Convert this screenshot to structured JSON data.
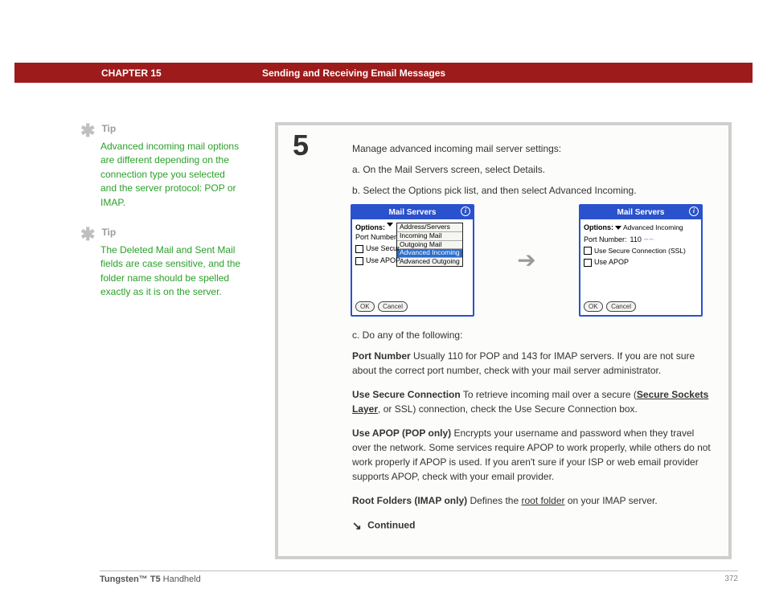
{
  "header": {
    "chapter": "CHAPTER 15",
    "subtitle": "Sending and Receiving Email Messages"
  },
  "tips": [
    {
      "label": "Tip",
      "text": "Advanced incoming mail options are different depending on the connection type you selected and the server protocol: POP or IMAP."
    },
    {
      "label": "Tip",
      "text": "The Deleted Mail and Sent Mail fields are case sensitive, and the folder name should be spelled exactly as it is on the server."
    }
  ],
  "step": {
    "number": "5",
    "intro": "Manage advanced incoming mail server settings:",
    "a": "a.  On the Mail Servers screen, select Details.",
    "b": "b.  Select the Options pick list, and then select Advanced Incoming.",
    "c": "c.  Do any of the following:"
  },
  "screen1": {
    "title": "Mail Servers",
    "options_label": "Options:",
    "port_label": "Port Number",
    "use_secure": "Use Secur",
    "use_apop": "Use APOP",
    "dropdown": [
      "Address/Servers",
      "Incoming Mail",
      "Outgoing Mail",
      "Advanced Incoming",
      "Advanced Outgoing"
    ],
    "ok": "OK",
    "cancel": "Cancel"
  },
  "screen2": {
    "title": "Mail Servers",
    "options_label": "Options:",
    "options_value": "Advanced Incoming",
    "port_label": "Port Number:",
    "port_value": "110",
    "use_secure": "Use Secure Connection (SSL)",
    "use_apop": "Use APOP",
    "ok": "OK",
    "cancel": "Cancel"
  },
  "descriptions": {
    "port_label": "Port Number",
    "port_text": "    Usually 110 for POP and 143 for IMAP servers. If you are not sure about the correct port number, check with your mail server administrator.",
    "secure_label": "Use Secure Connection",
    "secure_text_1": "    To retrieve incoming mail over a secure (",
    "secure_link": "Secure Sockets Layer",
    "secure_text_2": ", or SSL) connection, check the Use Secure Connection box.",
    "apop_label": "Use APOP (POP only)",
    "apop_text": "    Encrypts your username and password when they travel over the network. Some services require APOP to work properly, while others do not work properly if APOP is used. If you aren't sure if your ISP or web email provider supports APOP, check with your email provider.",
    "root_label": "Root Folders (IMAP only)",
    "root_text_1": "    Defines the ",
    "root_link": "root folder",
    "root_text_2": " on your IMAP server."
  },
  "continued": "Continued",
  "footer": {
    "product_bold": "Tungsten™ T5",
    "product_rest": " Handheld",
    "page": "372"
  }
}
